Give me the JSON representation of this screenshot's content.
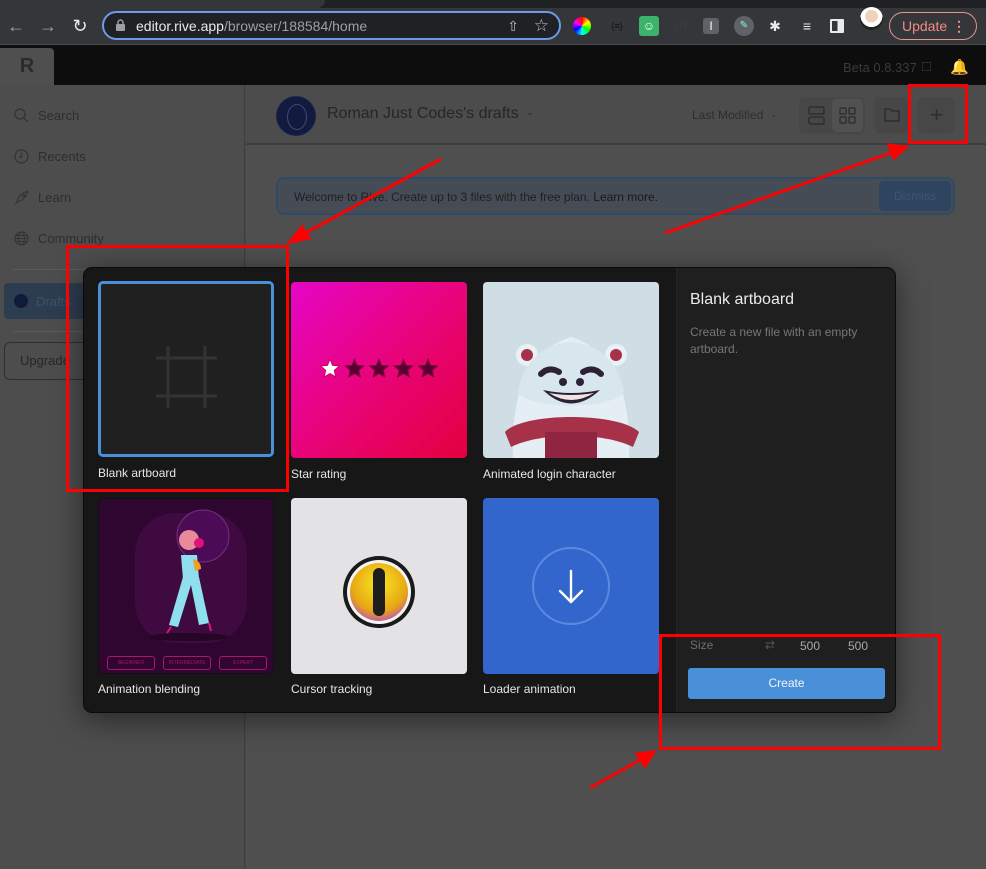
{
  "browser": {
    "url_host": "editor.rive.app",
    "url_path": "/browser/188584/home",
    "update_label": "Update",
    "extensions": [
      "color-wheel-extension-icon",
      "json-extension-icon",
      "bitmoji-extension-icon",
      "m-extension-icon",
      "i-extension-icon",
      "wrench-extension-icon",
      "puzzle-extensions-icon",
      "media-queue-icon",
      "side-panel-icon"
    ]
  },
  "app": {
    "logo": "R",
    "version": "Beta 0.8.337"
  },
  "sidebar": {
    "items": [
      {
        "label": "Search",
        "icon": "search-icon"
      },
      {
        "label": "Recents",
        "icon": "clock-icon"
      },
      {
        "label": "Learn",
        "icon": "rocket-icon"
      },
      {
        "label": "Community",
        "icon": "globe-icon"
      }
    ],
    "drafts_label": "Drafts",
    "upgrade_label": "Upgrade"
  },
  "header": {
    "team_name": "Roman Just Codes's drafts",
    "sort_label": "Last Modified"
  },
  "banner": {
    "text": "Welcome to Rive. Create up to 3 files with the free plan.",
    "link": "Learn more.",
    "dismiss_label": "Dismiss"
  },
  "modal": {
    "templates": [
      {
        "label": "Blank artboard",
        "selected": true
      },
      {
        "label": "Star rating",
        "rating": 1,
        "max": 5
      },
      {
        "label": "Animated login character"
      },
      {
        "label": "Animation blending",
        "tags": [
          "BEGINNER",
          "INTERMEDIATE",
          "EXPERT"
        ]
      },
      {
        "label": "Cursor tracking"
      },
      {
        "label": "Loader animation"
      }
    ],
    "detail": {
      "title": "Blank artboard",
      "description": "Create a new file with an empty artboard.",
      "size_label": "Size",
      "width": "500",
      "height": "500",
      "create_label": "Create"
    }
  },
  "colors": {
    "accent": "#4a90d9",
    "annotation": "#ff0000",
    "star_rating_bg_start": "#e605c6",
    "star_rating_bg_end": "#e4003e",
    "loader_bg": "#3366cc"
  }
}
